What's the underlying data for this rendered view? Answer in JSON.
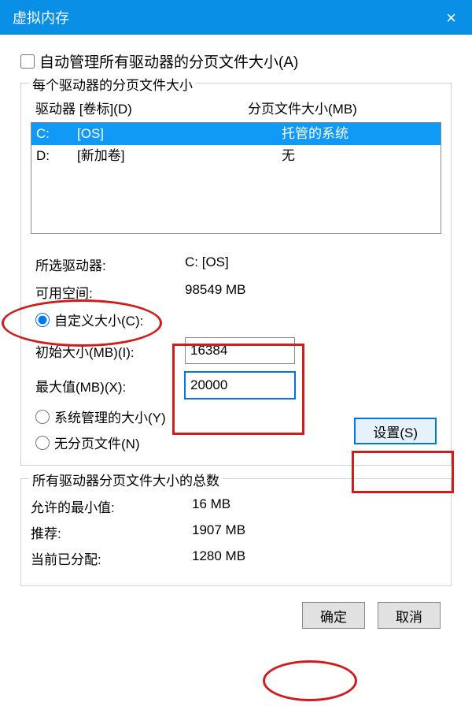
{
  "title": "虚拟内存",
  "autoManage": "自动管理所有驱动器的分页文件大小(A)",
  "group1": {
    "legend": "每个驱动器的分页文件大小",
    "header": {
      "drive": "驱动器 [卷标](D)",
      "pagefile": "分页文件大小(MB)"
    },
    "rows": [
      {
        "drive": "C:",
        "label": "[OS]",
        "value": "托管的系统"
      },
      {
        "drive": "D:",
        "label": "[新加卷]",
        "value": "无"
      }
    ],
    "selectedDrive": {
      "lbl": "所选驱动器:",
      "val": "C:  [OS]"
    },
    "freeSpace": {
      "lbl": "可用空间:",
      "val": "98549 MB"
    },
    "customSize": "自定义大小(C):",
    "initial": {
      "lbl": "初始大小(MB)(I):",
      "val": "16384"
    },
    "max": {
      "lbl": "最大值(MB)(X):",
      "val": "20000"
    },
    "systemManaged": "系统管理的大小(Y)",
    "noPage": "无分页文件(N)",
    "setBtn": "设置(S)"
  },
  "group2": {
    "legend": "所有驱动器分页文件大小的总数",
    "min": {
      "lbl": "允许的最小值:",
      "val": "16 MB"
    },
    "rec": {
      "lbl": "推荐:",
      "val": "1907 MB"
    },
    "cur": {
      "lbl": "当前已分配:",
      "val": "1280 MB"
    }
  },
  "ok": "确定",
  "cancel": "取消"
}
